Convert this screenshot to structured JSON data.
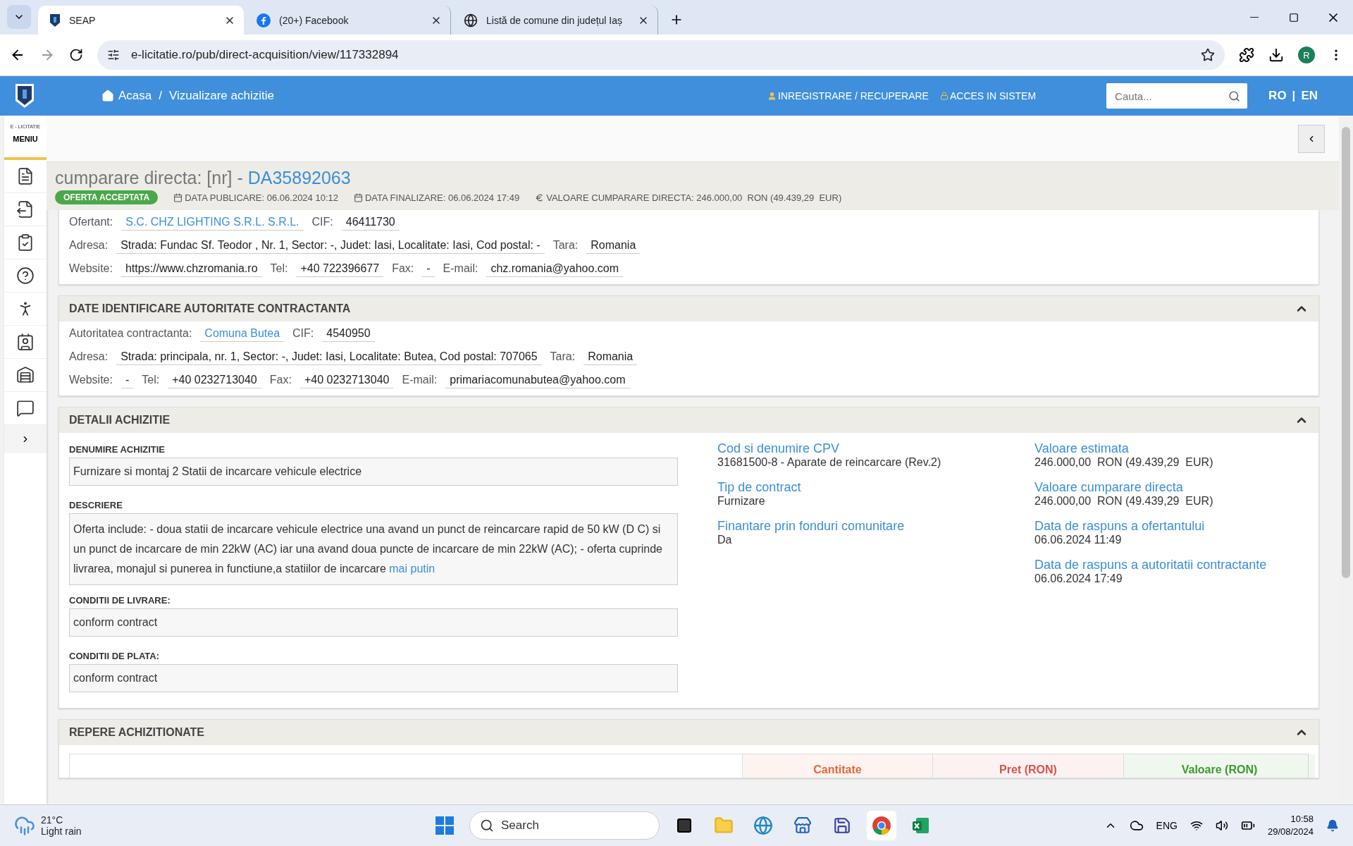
{
  "browser": {
    "tabs": [
      {
        "label": "SEAP",
        "selected": true
      },
      {
        "label": "(20+) Facebook",
        "selected": false
      },
      {
        "label": "Listă de comune din județul Iaș",
        "selected": false
      }
    ],
    "url": "e-licitatie.ro/pub/direct-acquisition/view/117332894",
    "profile_initial": "R"
  },
  "header": {
    "breadcrumb": [
      "Acasa",
      "Vizualizare achizitie"
    ],
    "breadcrumb_separator": "/",
    "links": [
      "INREGISTRARE / RECUPERARE",
      "ACCES IN SISTEM"
    ],
    "search": {
      "placeholder": "Cauta..."
    },
    "languages": [
      "RO",
      "EN"
    ],
    "language_separator": "|"
  },
  "sidebar": {
    "brand": "E - LICITATIE",
    "menu_label": "MENIU"
  },
  "title": {
    "prefix": "cumparare directa: [nr] - ",
    "code": "DA35892063",
    "status": "OFERTA ACCEPTATA",
    "meta": [
      {
        "kind": "calendar",
        "text": "DATA PUBLICARE: 06.06.2024 10:12"
      },
      {
        "kind": "calendar",
        "text": "DATA FINALIZARE: 06.06.2024 17:49"
      },
      {
        "kind": "euro",
        "text": "VALOARE CUMPARARE DIRECTA: 246.000,00  RON (49.439,29  EUR)"
      }
    ]
  },
  "bidder": {
    "lines": [
      {
        "fields": [
          {
            "label": "Ofertant:",
            "value": "S.C. CHZ LIGHTING S.R.L. S.R.L.",
            "kind": "link"
          },
          {
            "label": "CIF:",
            "value": "46411730",
            "kind": "text"
          }
        ]
      },
      {
        "fields": [
          {
            "label": "Adresa:",
            "value": "Strada: Fundac Sf. Teodor , Nr. 1, Sector: -, Judet: Iasi, Localitate: Iasi, Cod postal: -",
            "kind": "text"
          },
          {
            "label": "Tara:",
            "value": "Romania",
            "kind": "text"
          }
        ]
      },
      {
        "fields": [
          {
            "label": "Website:",
            "value": "https://www.chzromania.ro",
            "kind": "text"
          },
          {
            "label": "Tel:",
            "value": "+40 722396677",
            "kind": "text"
          },
          {
            "label": "Fax:",
            "value": "-",
            "kind": "text"
          },
          {
            "label": "E-mail:",
            "value": "chz.romania@yahoo.com",
            "kind": "text"
          }
        ]
      }
    ]
  },
  "authority": {
    "title": "DATE IDENTIFICARE AUTORITATE CONTRACTANTA",
    "expanded": true,
    "lines": [
      {
        "fields": [
          {
            "label": "Autoritatea contractanta:",
            "value": "Comuna Butea",
            "kind": "link"
          },
          {
            "label": "CIF:",
            "value": "4540950",
            "kind": "text"
          }
        ]
      },
      {
        "fields": [
          {
            "label": "Adresa:",
            "value": "Strada: principala, nr. 1, Sector: -, Judet: Iasi, Localitate: Butea, Cod postal: 707065",
            "kind": "text"
          },
          {
            "label": "Tara:",
            "value": "Romania",
            "kind": "text"
          }
        ]
      },
      {
        "fields": [
          {
            "label": "Website:",
            "value": "-",
            "kind": "text"
          },
          {
            "label": "Tel:",
            "value": "+40 0232713040",
            "kind": "text"
          },
          {
            "label": "Fax:",
            "value": "+40 0232713040",
            "kind": "text"
          },
          {
            "label": "E-mail:",
            "value": "primariacomunabutea@yahoo.com",
            "kind": "text"
          }
        ]
      }
    ]
  },
  "details": {
    "title": "DETALII ACHIZITIE",
    "expanded": true,
    "fields": [
      {
        "label": "DENUMIRE ACHIZITIE",
        "value": "Furnizare si montaj 2 Statii de incarcare vehicule electrice"
      },
      {
        "label": "DESCRIERE",
        "value": "Oferta include: - doua statii de incarcare vehicule electrice una avand un punct de reincarcare rapid de 50 kW (D C) si un punct de incarcare de min 22kW (AC) iar una avand doua puncte de incarcare de min 22kW (AC); - oferta cuprinde livrarea, monajul si punerea in functiune,a statiilor de incarcare",
        "more_link": "mai putin"
      },
      {
        "label": "CONDITII DE LIVRARE:",
        "value": "conform contract"
      },
      {
        "label": "CONDITII DE PLATA:",
        "value": "conform contract"
      }
    ],
    "info_columns": [
      {
        "entries": [
          {
            "label": "Cod si denumire CPV",
            "value": "31681500-8 - Aparate de reincarcare (Rev.2)"
          },
          {
            "label": "Tip de contract",
            "value": "Furnizare"
          },
          {
            "label": "Finantare prin fonduri comunitare",
            "value": "Da"
          }
        ]
      },
      {
        "entries": [
          {
            "label": "Valoare estimata",
            "value": "246.000,00  RON (49.439,29  EUR)"
          },
          {
            "label": "Valoare cumparare directa",
            "value": "246.000,00  RON (49.439,29  EUR)"
          },
          {
            "label": "Data de raspuns a ofertantului",
            "value": "06.06.2024 11:49"
          },
          {
            "label": "Data de raspuns a autoritatii contractante",
            "value": "06.06.2024 17:49"
          }
        ]
      }
    ]
  },
  "items": {
    "title": "REPERE ACHIZITIONATE",
    "expanded": true,
    "columns": [
      {
        "label": "Cantitate",
        "color": "#e8663d"
      },
      {
        "label": "Pret (RON)",
        "color": "#d9534f"
      },
      {
        "label": "Valoare (RON)",
        "color": "#3c9a2e"
      }
    ]
  },
  "taskbar": {
    "weather": {
      "temp": "21°C",
      "desc": "Light rain"
    },
    "search": {
      "placeholder": "Search"
    },
    "language": "ENG",
    "time": "10:58",
    "date": "29/08/2024"
  }
}
